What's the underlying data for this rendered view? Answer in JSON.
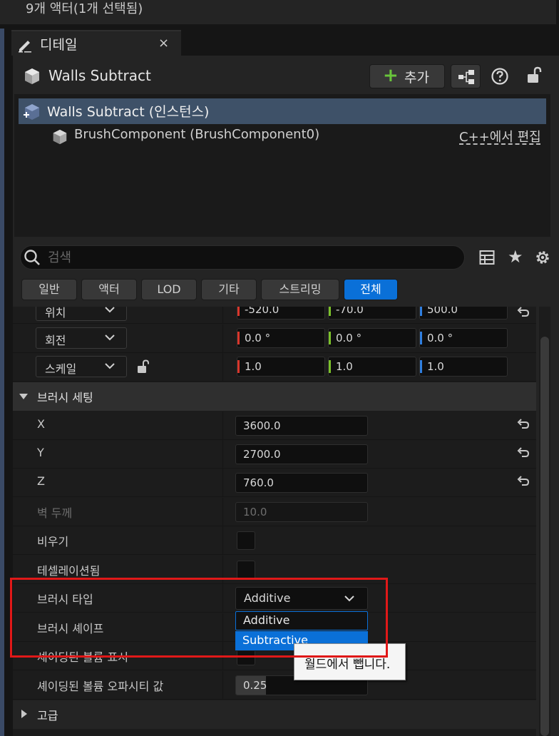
{
  "selection_status": "9개 액터(1개 선택됨)",
  "details_tab": {
    "label": "디테일",
    "close": "×"
  },
  "header": {
    "actor_name": "Walls Subtract",
    "add_label": "추가"
  },
  "component_tree": {
    "root": "Walls Subtract (인스턴스)",
    "child": "BrushComponent (BrushComponent0)",
    "edit_link": "C++에서 편집"
  },
  "search": {
    "placeholder": "검색",
    "value": ""
  },
  "filter_tabs": [
    "일반",
    "액터",
    "LOD",
    "기타",
    "스트리밍",
    "전체"
  ],
  "active_filter": "전체",
  "transform": {
    "location": {
      "label": "위치",
      "x": "-520.0",
      "y": "-70.0",
      "z": "500.0"
    },
    "rotation": {
      "label": "회전",
      "x": "0.0 °",
      "y": "0.0 °",
      "z": "0.0 °"
    },
    "scale": {
      "label": "스케일",
      "x": "1.0",
      "y": "1.0",
      "z": "1.0"
    }
  },
  "brush_settings": {
    "section_label": "브러시 세팅",
    "x": {
      "label": "X",
      "value": "3600.0"
    },
    "y": {
      "label": "Y",
      "value": "2700.0"
    },
    "z": {
      "label": "Z",
      "value": "760.0"
    },
    "wall_thickness": {
      "label": "벽 두께",
      "value": "10.0"
    },
    "hollow": {
      "label": "비우기"
    },
    "tessellated": {
      "label": "테셀레이션됨"
    },
    "brush_type": {
      "label": "브러시 타입",
      "value": "Additive",
      "options": [
        "Additive",
        "Subtractive"
      ]
    },
    "brush_shape": {
      "label": "브러시 셰이프"
    },
    "shaded_volume": {
      "label": "셰이딩된 볼륨 표시"
    },
    "shaded_opacity": {
      "label": "셰이딩된 볼륨 오파시티 값",
      "value": "0.25"
    }
  },
  "advanced_section": "고급",
  "tooltip": "월드에서 뺍니다.",
  "colors": {
    "accent": "#0a70d8",
    "highlight": "#e01818",
    "axis_x": "#d8362b",
    "axis_y": "#7bc12a",
    "axis_z": "#2f7fe0",
    "add_plus": "#69c53b"
  }
}
